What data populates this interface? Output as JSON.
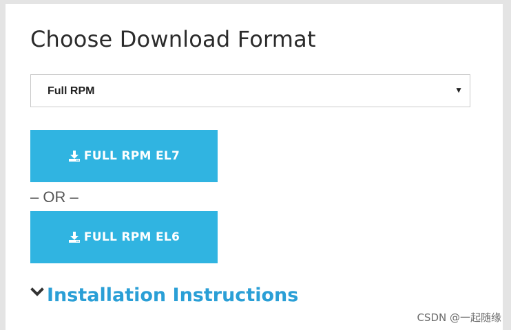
{
  "page": {
    "title": "Choose Download Format"
  },
  "format_select": {
    "selected": "Full RPM",
    "caret_icon": "triangle-down-icon"
  },
  "downloads": [
    {
      "label": "FULL RPM EL7",
      "icon": "download-icon",
      "color": "#30b4e1"
    },
    {
      "label": "FULL RPM EL6",
      "icon": "download-icon",
      "color": "#30b4e1"
    }
  ],
  "separator": "– OR –",
  "installation": {
    "label": "Installation Instructions",
    "icon": "chevron-down-icon",
    "color": "#2a9fd6"
  },
  "watermark": "CSDN @一起随缘"
}
